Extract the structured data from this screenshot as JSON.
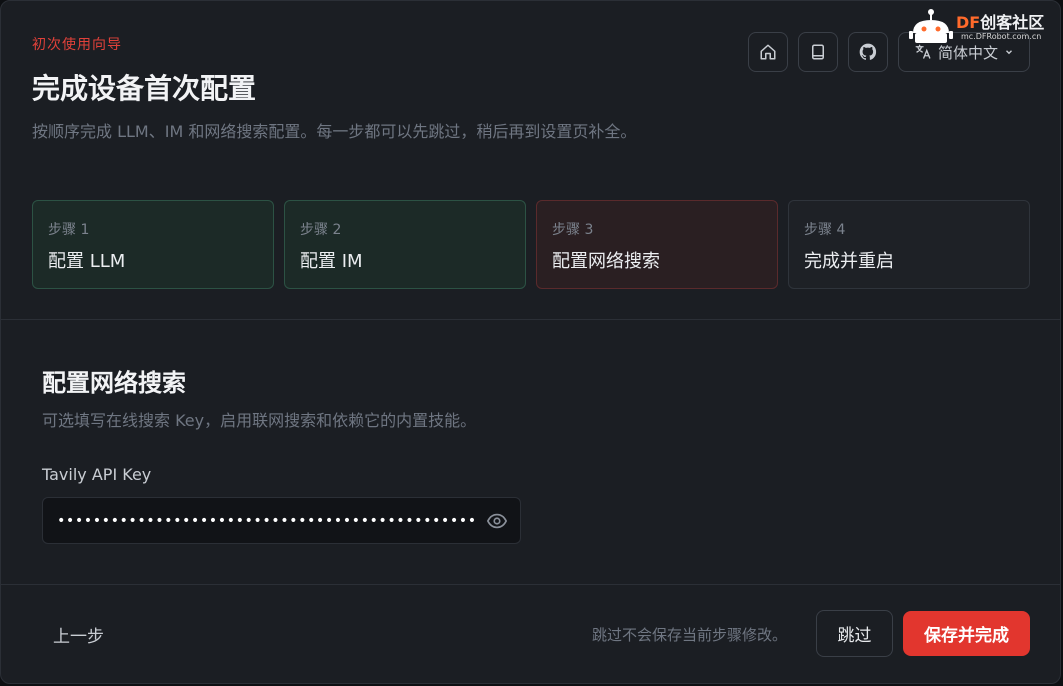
{
  "header": {
    "eyebrow": "初次使用向导",
    "title": "完成设备首次配置",
    "subtitle": "按顺序完成 LLM、IM 和网络搜索配置。每一步都可以先跳过，稍后再到设置页补全。"
  },
  "toolbar": {
    "language_label": "简体中文"
  },
  "watermark": {
    "brand_df": "DF",
    "brand_rest": "创客社区",
    "url": "mc.DFRobot.com.cn"
  },
  "steps": [
    {
      "num": "步骤 1",
      "label": "配置 LLM",
      "state": "done"
    },
    {
      "num": "步骤 2",
      "label": "配置 IM",
      "state": "done"
    },
    {
      "num": "步骤 3",
      "label": "配置网络搜索",
      "state": "active"
    },
    {
      "num": "步骤 4",
      "label": "完成并重启",
      "state": "pending"
    }
  ],
  "section": {
    "title": "配置网络搜索",
    "description": "可选填写在线搜索 Key，启用联网搜索和依赖它的内置技能。",
    "field_label": "Tavily API Key",
    "field_value": "tvly-dev-xxxxxxxxxxxxxxxxxxxxxxxxxxxxxxxxxxxxxxxxxx"
  },
  "footer": {
    "back_label": "上一步",
    "hint": "跳过不会保存当前步骤修改。",
    "skip_label": "跳过",
    "save_label": "保存并完成"
  },
  "colors": {
    "accent": "#e2362e",
    "done_bg": "#1c2a27",
    "active_bg": "#2a1f22"
  }
}
